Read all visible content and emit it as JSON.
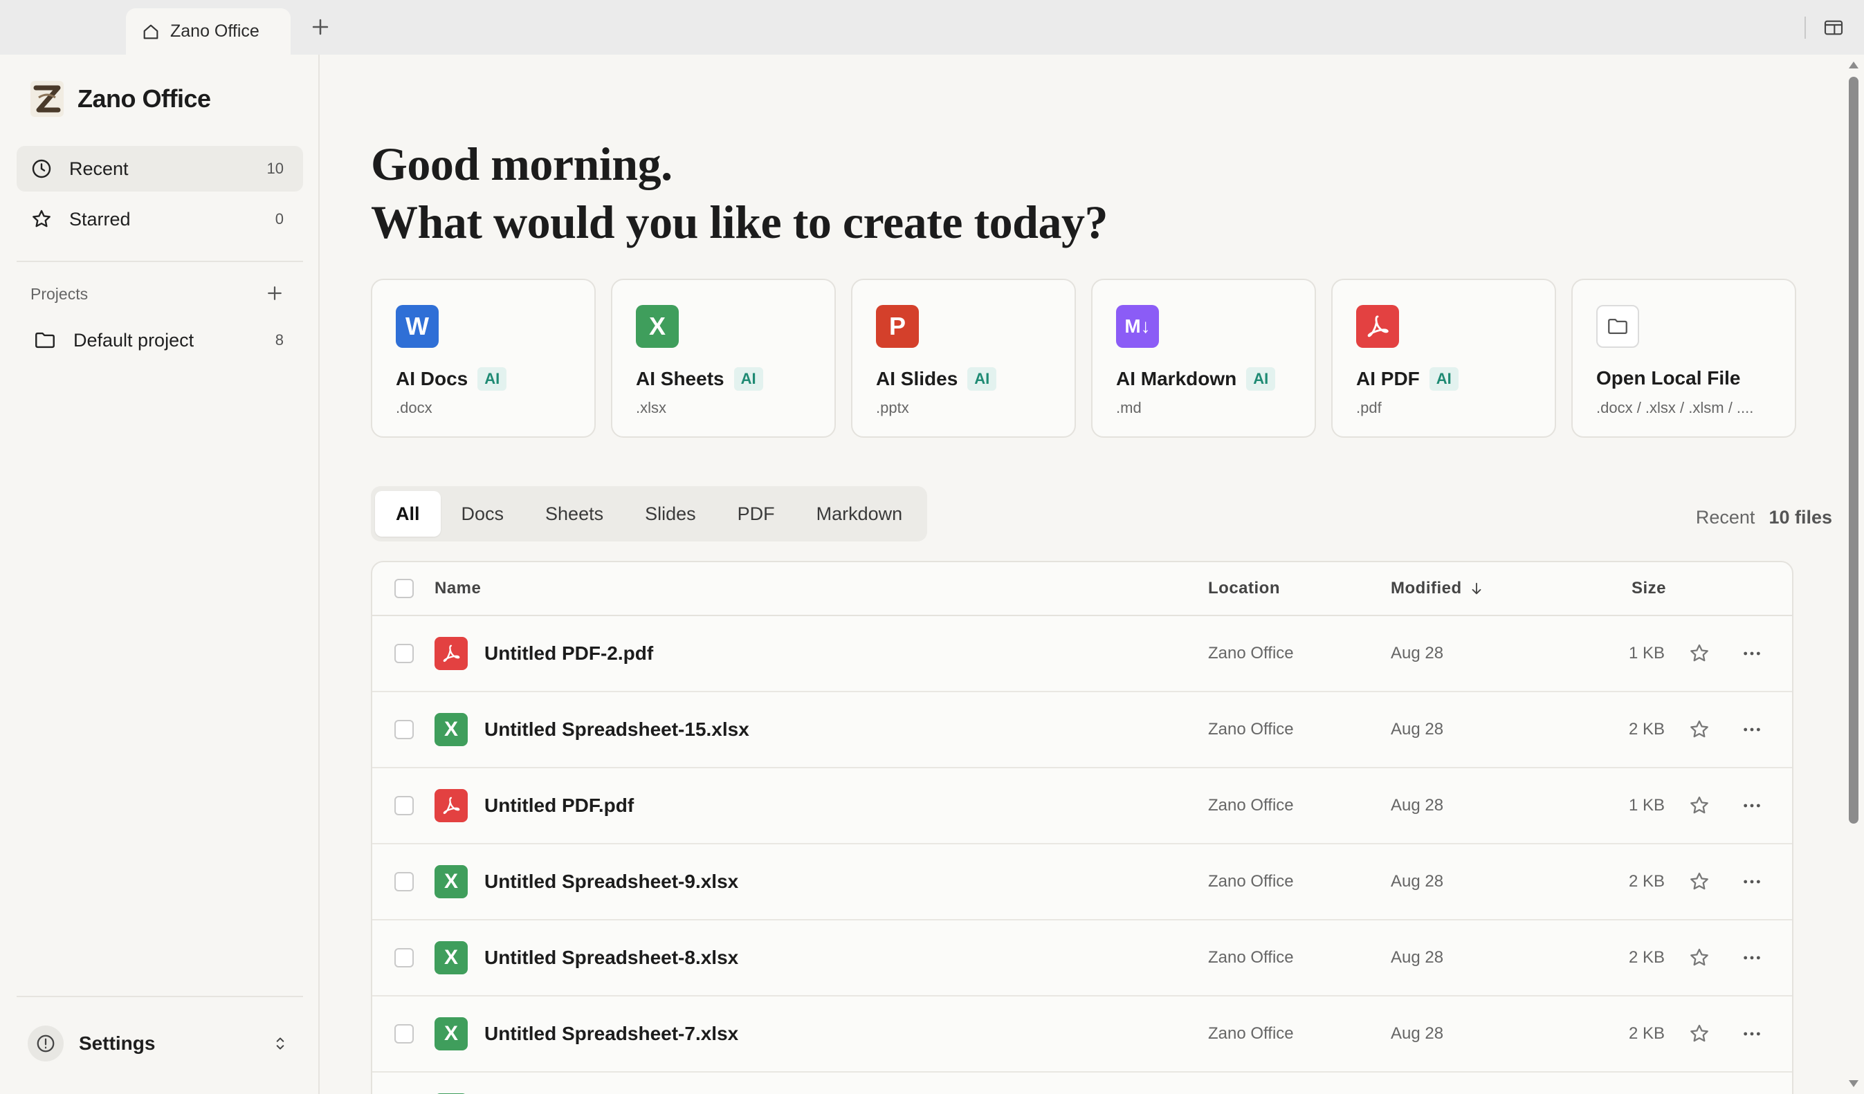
{
  "browser": {
    "tab_title": "Zano Office",
    "new_tab_icon": "plus-icon",
    "sidebar_toggle_icon": "sidebar-panel-icon"
  },
  "sidebar": {
    "brand_name": "Zano Office",
    "nav": [
      {
        "label": "Recent",
        "count": "10",
        "icon": "clock-icon",
        "active": true
      },
      {
        "label": "Starred",
        "count": "0",
        "icon": "star-icon",
        "active": false
      }
    ],
    "projects_label": "Projects",
    "projects": [
      {
        "label": "Default project",
        "count": "8",
        "icon": "folder-icon"
      }
    ],
    "settings_label": "Settings"
  },
  "main": {
    "greeting_line1": "Good morning.",
    "greeting_line2": "What would you like to create today?",
    "create_cards": [
      {
        "title": "AI Docs",
        "badge": "AI",
        "ext": ".docx",
        "glyph": "W",
        "color": "#2f6fd6"
      },
      {
        "title": "AI Sheets",
        "badge": "AI",
        "ext": ".xlsx",
        "glyph": "X",
        "color": "#3f9e5c"
      },
      {
        "title": "AI Slides",
        "badge": "AI",
        "ext": ".pptx",
        "glyph": "P",
        "color": "#d4402b"
      },
      {
        "title": "AI Markdown",
        "badge": "AI",
        "ext": ".md",
        "glyph": "M↓",
        "color": "#8b5cf6"
      },
      {
        "title": "AI PDF",
        "badge": "AI",
        "ext": ".pdf",
        "glyph": "pdf",
        "color": "#e34141"
      },
      {
        "title": "Open Local File",
        "badge": "",
        "ext": ".docx / .xlsx / .xlsm / ....",
        "glyph": "folder",
        "color": "#ffffff"
      }
    ],
    "filters": [
      "All",
      "Docs",
      "Sheets",
      "Slides",
      "PDF",
      "Markdown"
    ],
    "active_filter": "All",
    "recent_label": "Recent",
    "recent_count": "10 files",
    "table": {
      "columns": {
        "name": "Name",
        "location": "Location",
        "modified": "Modified",
        "size": "Size"
      },
      "rows": [
        {
          "name": "Untitled PDF-2.pdf",
          "type": "pdf",
          "location": "Zano Office",
          "modified": "Aug 28",
          "size": "1 KB"
        },
        {
          "name": "Untitled Spreadsheet-15.xlsx",
          "type": "xlsx",
          "location": "Zano Office",
          "modified": "Aug 28",
          "size": "2 KB"
        },
        {
          "name": "Untitled PDF.pdf",
          "type": "pdf",
          "location": "Zano Office",
          "modified": "Aug 28",
          "size": "1 KB"
        },
        {
          "name": "Untitled Spreadsheet-9.xlsx",
          "type": "xlsx",
          "location": "Zano Office",
          "modified": "Aug 28",
          "size": "2 KB"
        },
        {
          "name": "Untitled Spreadsheet-8.xlsx",
          "type": "xlsx",
          "location": "Zano Office",
          "modified": "Aug 28",
          "size": "2 KB"
        },
        {
          "name": "Untitled Spreadsheet-7.xlsx",
          "type": "xlsx",
          "location": "Zano Office",
          "modified": "Aug 28",
          "size": "2 KB"
        },
        {
          "name": "",
          "type": "xlsx",
          "location": "",
          "modified": "",
          "size": ""
        }
      ]
    }
  },
  "colors": {
    "pdf": "#e34141",
    "xlsx": "#3f9e5c",
    "ai_badge_bg": "#e3f2ef",
    "ai_badge_text": "#1e8a73"
  }
}
